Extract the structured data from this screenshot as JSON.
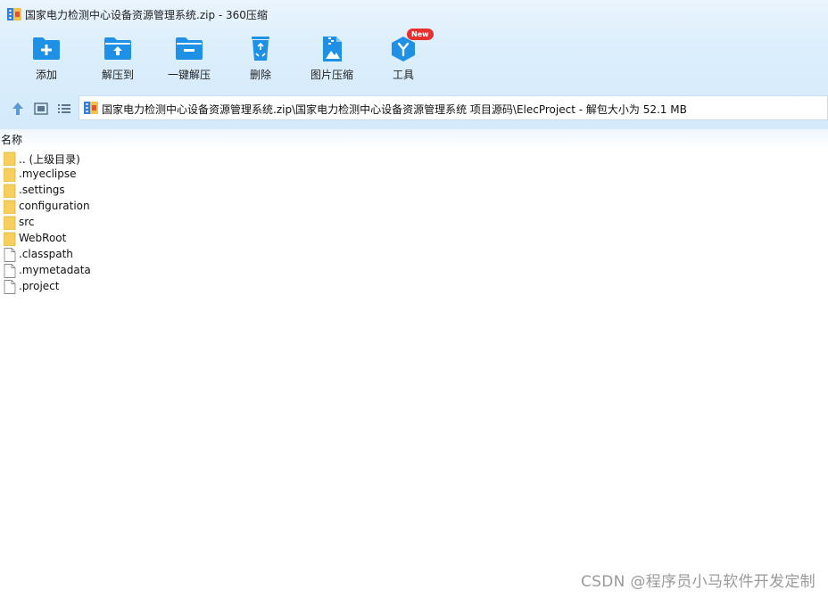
{
  "window": {
    "title": "国家电力检测中心设备资源管理系统.zip - 360压缩"
  },
  "toolbar": {
    "items": [
      {
        "label": "添加",
        "icon": "add-folder-icon"
      },
      {
        "label": "解压到",
        "icon": "extract-to-icon"
      },
      {
        "label": "一键解压",
        "icon": "one-click-extract-icon"
      },
      {
        "label": "删除",
        "icon": "recycle-delete-icon"
      },
      {
        "label": "图片压缩",
        "icon": "image-compress-icon"
      },
      {
        "label": "工具",
        "icon": "tools-icon",
        "badge": "New"
      }
    ]
  },
  "nav": {
    "up_icon": "arrow-up-icon",
    "view_thumb_icon": "thumbnail-view-icon",
    "view_list_icon": "list-view-icon",
    "path": "国家电力检测中心设备资源管理系统.zip\\国家电力检测中心设备资源管理系统 项目源码\\ElecProject - 解包大小为 52.1 MB"
  },
  "list": {
    "column_name": "名称",
    "rows": [
      {
        "name": ".. (上级目录)",
        "type": "folder"
      },
      {
        "name": ".myeclipse",
        "type": "folder"
      },
      {
        "name": ".settings",
        "type": "folder"
      },
      {
        "name": "configuration",
        "type": "folder"
      },
      {
        "name": "src",
        "type": "folder"
      },
      {
        "name": "WebRoot",
        "type": "folder"
      },
      {
        "name": ".classpath",
        "type": "file"
      },
      {
        "name": ".mymetadata",
        "type": "file"
      },
      {
        "name": ".project",
        "type": "file"
      }
    ]
  },
  "watermark": "CSDN @程序员小马软件开发定制",
  "colors": {
    "accent": "#1e90e6",
    "folder": "#f7cf5e",
    "badge": "#e8312f"
  }
}
